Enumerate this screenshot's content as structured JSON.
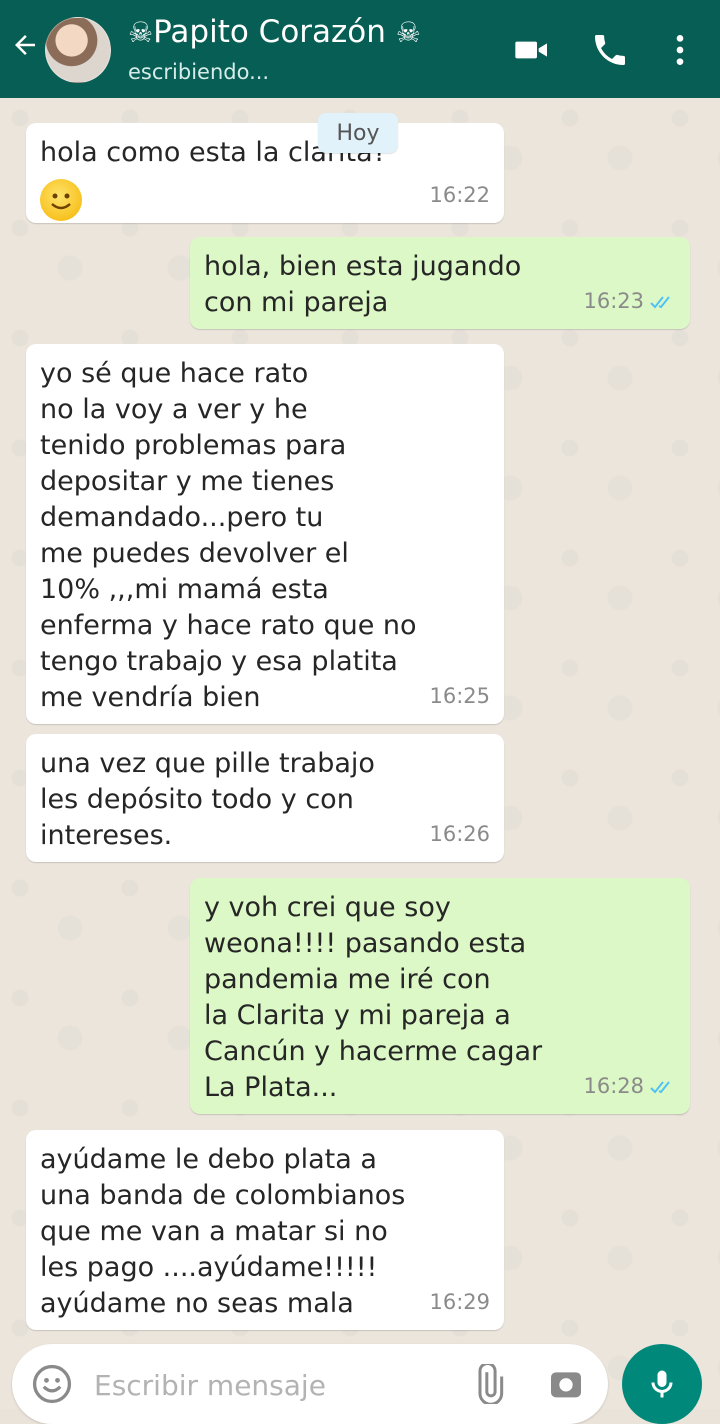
{
  "header": {
    "back_icon": "arrow-left-icon",
    "contact_name": "Papito Corazón",
    "name_decoration": "☠",
    "status": "escribiendo...",
    "icons": [
      "video-call-icon",
      "phone-icon",
      "more-vert-icon"
    ],
    "color": "#075e54"
  },
  "date_separator": "Hoy",
  "messages": [
    {
      "direction": "in",
      "text": "hola como esta la clarita?",
      "time": "16:22",
      "has_emoji": true
    },
    {
      "direction": "out",
      "text": "hola, bien esta jugando\ncon mi pareja",
      "time": "16:23",
      "read": true
    },
    {
      "direction": "in",
      "text": "yo sé que hace rato\nno la voy a ver y he\ntenido problemas para\ndepositar y me tienes\ndemandado...pero tu\nme puedes devolver el\n10% ,,,mi mamá esta\nenferma y hace rato que no\ntengo trabajo y esa platita\nme vendría bien",
      "time": "16:25"
    },
    {
      "direction": "in",
      "text": "una vez que pille trabajo\nles depósito todo y con\nintereses.",
      "time": "16:26"
    },
    {
      "direction": "out",
      "text": "y voh crei que soy\nweona!!!! pasando esta\npandemia me iré con\nla Clarita y mi pareja a\nCancún y hacerme cagar\nLa Plata...",
      "time": "16:28",
      "read": true
    },
    {
      "direction": "in",
      "text": "ayúdame le debo plata a\nuna banda de colombianos\nque me van a matar si no\nles pago ....ayúdame!!!!!\nayúdame no seas mala",
      "time": "16:29"
    }
  ],
  "input": {
    "placeholder": "Escribir mensaje",
    "icons": [
      "emoji-icon",
      "attach-icon",
      "camera-icon",
      "mic-icon"
    ]
  },
  "colors": {
    "incoming": "#ffffff",
    "outgoing": "#dcf8c6",
    "accent": "#00897b",
    "read_ticks": "#4fc3f7"
  }
}
